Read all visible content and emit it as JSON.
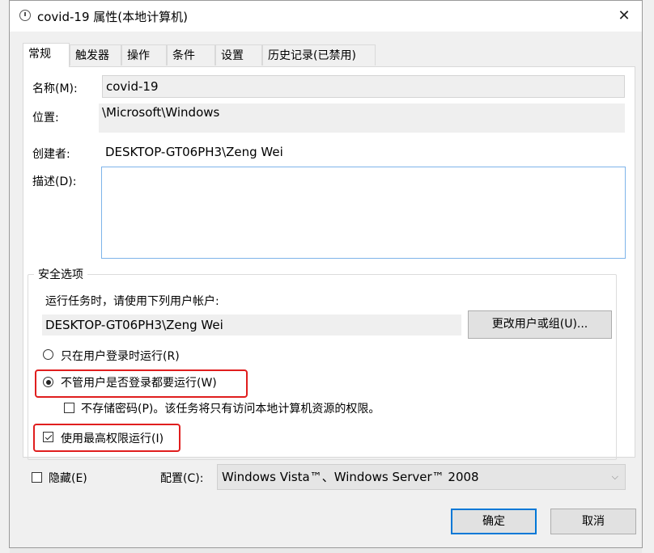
{
  "window": {
    "title": "covid-19 属性(本地计算机)",
    "close_glyph": "✕"
  },
  "tabs": [
    {
      "label": "常规",
      "active": true
    },
    {
      "label": "触发器"
    },
    {
      "label": "操作"
    },
    {
      "label": "条件"
    },
    {
      "label": "设置"
    },
    {
      "label": "历史记录(已禁用)"
    }
  ],
  "general": {
    "name_label": "名称(M):",
    "name_value": "covid-19",
    "location_label": "位置:",
    "location_value": "\\Microsoft\\Windows",
    "author_label": "创建者:",
    "author_value": "DESKTOP-GT06PH3\\Zeng Wei",
    "description_label": "描述(D):",
    "description_value": ""
  },
  "security": {
    "group_title": "安全选项",
    "run_as_label": "运行任务时，请使用下列用户帐户:",
    "run_as_value": "DESKTOP-GT06PH3\\Zeng Wei",
    "change_user_button": "更改用户或组(U)...",
    "radio_logged_on": {
      "label": "只在用户登录时运行(R)",
      "checked": false
    },
    "radio_whether_logged": {
      "label": "不管用户是否登录都要运行(W)",
      "checked": true
    },
    "do_not_store_password": {
      "label": "不存储密码(P)。该任务将只有访问本地计算机资源的权限。",
      "checked": false
    },
    "run_highest": {
      "label": "使用最高权限运行(I)",
      "checked": true
    },
    "highlight_color": "#e01e1e"
  },
  "hidden": {
    "label": "隐藏(E)",
    "checked": false
  },
  "configure": {
    "label": "配置(C):",
    "value": "Windows Vista™、Windows Server™ 2008"
  },
  "buttons": {
    "ok": "确定",
    "cancel": "取消"
  },
  "accent_color": "#0078d7"
}
